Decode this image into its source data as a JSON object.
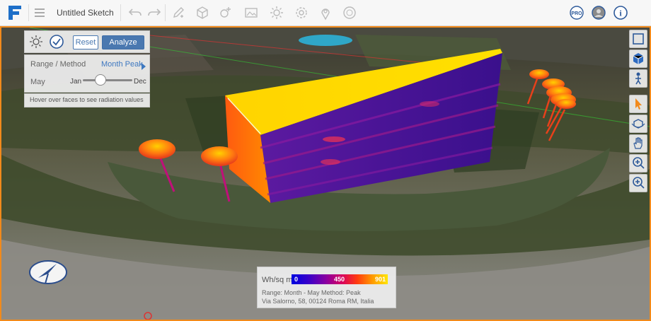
{
  "app": {
    "title": "Untitled Sketch"
  },
  "toolbar": {
    "icons": [
      "logo-icon",
      "menu-icon",
      "undo-icon",
      "redo-icon",
      "pencil-icon",
      "box-icon",
      "add-object-icon",
      "image-icon",
      "sun-icon",
      "gear-icon",
      "location-icon",
      "badge-icon"
    ],
    "right": {
      "pro_label": "PRO",
      "info_label": "i"
    }
  },
  "analysis_panel": {
    "reset_label": "Reset",
    "analyze_label": "Analyze",
    "range_label": "Range / Method",
    "range_value": "Month Peak",
    "month_label": "May",
    "slider_start": "Jan",
    "slider_end": "Dec",
    "slider_value": 0.36,
    "hint": "Hover over faces to see radiation values"
  },
  "legend": {
    "unit": "Wh/sq m",
    "min": "0",
    "mid": "450",
    "max": "901",
    "range_line": "Range:  Month - May    Method:  Peak",
    "address": "Via Salorno, 58, 00124 Roma RM, Italia"
  },
  "colors": {
    "accent": "#f28a1b",
    "button": "#4a78b0"
  }
}
